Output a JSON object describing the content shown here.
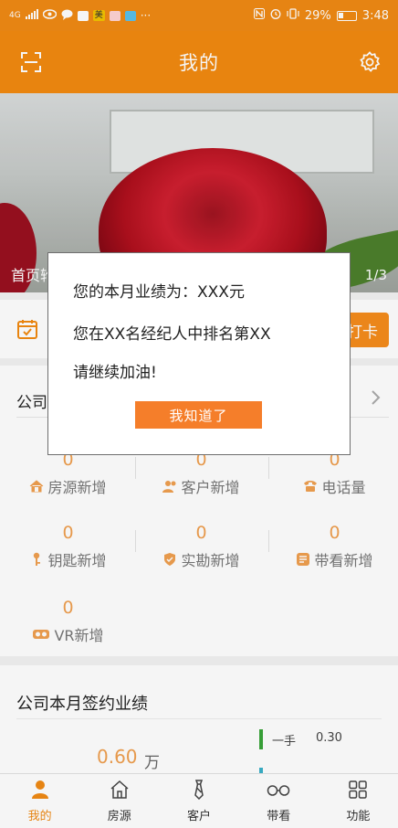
{
  "status_bar": {
    "network": "4G",
    "battery": "29%",
    "time": "3:48",
    "badge_mei": "美",
    "more": "···"
  },
  "header": {
    "title": "我的"
  },
  "banner": {
    "caption": "首页轮",
    "counter": "1/3"
  },
  "checkin": {
    "button": "打卡"
  },
  "company_stats": {
    "title": "公司",
    "items": [
      {
        "value": "0",
        "label": "房源新增",
        "icon": "house-icon"
      },
      {
        "value": "0",
        "label": "客户新增",
        "icon": "users-icon"
      },
      {
        "value": "0",
        "label": "电话量",
        "icon": "phone-icon"
      },
      {
        "value": "0",
        "label": "钥匙新增",
        "icon": "key-icon"
      },
      {
        "value": "0",
        "label": "实勘新增",
        "icon": "shield-icon"
      },
      {
        "value": "0",
        "label": "带看新增",
        "icon": "clipboard-icon"
      },
      {
        "value": "0",
        "label": "VR新增",
        "icon": "vr-icon"
      }
    ]
  },
  "sign_perf": {
    "title": "公司本月签约业绩",
    "amount": "0.60",
    "unit": "万",
    "legend_label": "一手",
    "legend_value": "0.30"
  },
  "bottom_nav": [
    {
      "label": "我的",
      "icon": "person-icon",
      "active": true
    },
    {
      "label": "房源",
      "icon": "house-icon",
      "active": false
    },
    {
      "label": "客户",
      "icon": "tie-icon",
      "active": false
    },
    {
      "label": "带看",
      "icon": "glasses-icon",
      "active": false
    },
    {
      "label": "功能",
      "icon": "grid-icon",
      "active": false
    }
  ],
  "dialog": {
    "line1": "您的本月业绩为：XXX元",
    "line2": "您在XX名经纪人中排名第XX",
    "line3": "请继续加油!",
    "button": "我知道了"
  },
  "colors": {
    "accent": "#f28a10",
    "button": "#f57e2a",
    "number": "#f0a050"
  }
}
